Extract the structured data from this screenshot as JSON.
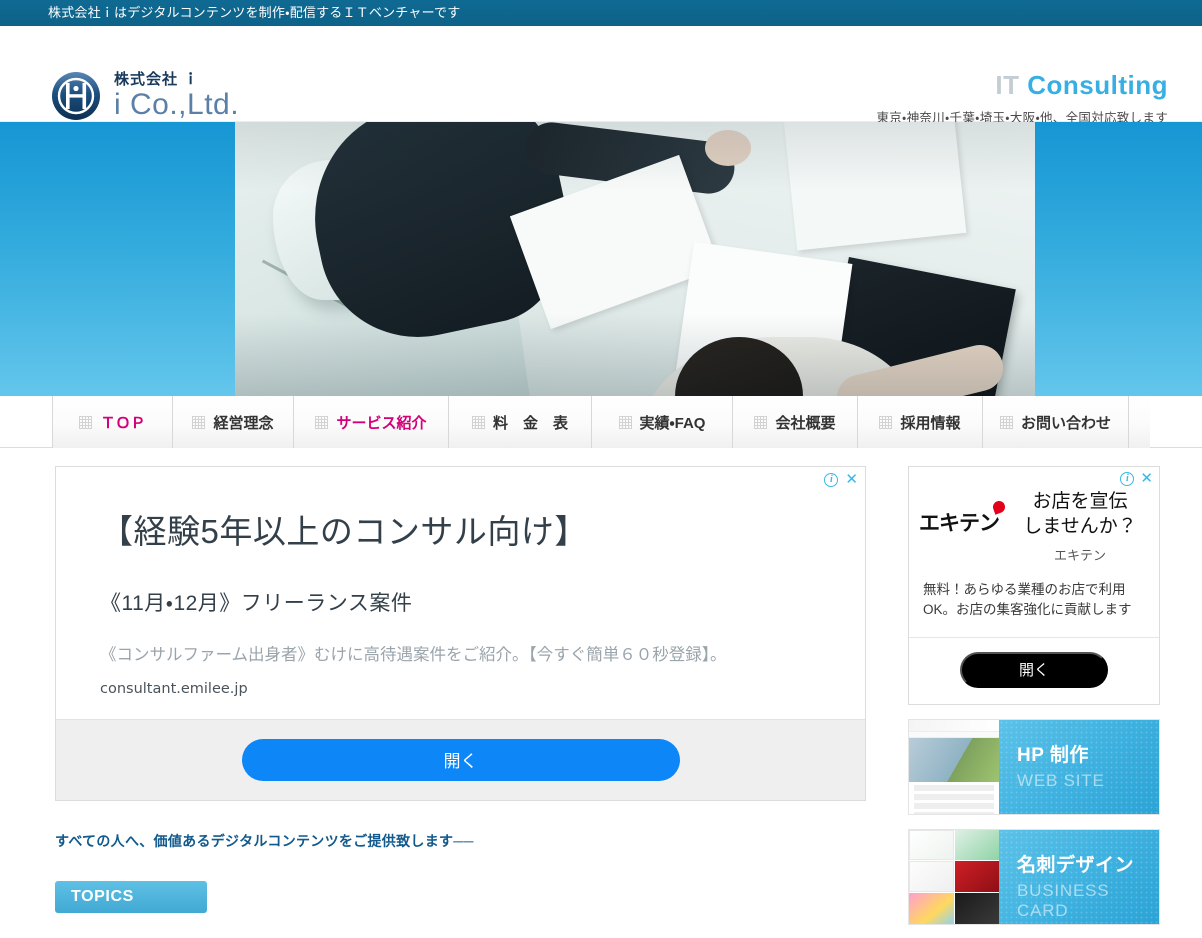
{
  "topbar": {
    "notice": "株式会社ｉはデジタルコンテンツを制作・配信するＩＴベンチャーです"
  },
  "header": {
    "logo_kana": "株式会社 ｉ",
    "logo_en": "i Co.,Ltd.",
    "title_it": "IT",
    "title_consulting": "Consulting",
    "subtitle": "東京・神奈川・千葉・埼玉・大阪・他、全国対応致します"
  },
  "nav": {
    "items": [
      {
        "label": "ＴＯＰ",
        "accent": true
      },
      {
        "label": "経営理念",
        "accent": false
      },
      {
        "label": "サービス紹介",
        "accent": true
      },
      {
        "label": "料　金　表",
        "accent": false
      },
      {
        "label": "実績・FAQ",
        "accent": false
      },
      {
        "label": "会社概要",
        "accent": false
      },
      {
        "label": "採用情報",
        "accent": false
      },
      {
        "label": "お問い合わせ",
        "accent": false
      }
    ]
  },
  "main_ad": {
    "headline": "【経験5年以上のコンサル向け】",
    "subhead": "《11月・12月》フリーランス案件",
    "description": "《コンサルファーム出身者》むけに高待遇案件をご紹介。【今すぐ簡単６０秒登録】。",
    "url": "consultant.emilee.jp",
    "cta": "開く",
    "info_icon": "info-icon",
    "close_icon": "close-icon"
  },
  "content": {
    "tagline": "すべての人へ、価値あるデジタルコンテンツをご提供致します──",
    "topics_label": "TOPICS"
  },
  "side_ad": {
    "brand_logo": "エキテン",
    "headline": "お店を宣伝\nしませんか？",
    "headline_line1": "お店を宣伝",
    "headline_line2": "しませんか？",
    "brand": "エキテン",
    "description": "無料！あらゆる業種のお店で利用OK。お店の集客強化に貢献します",
    "cta": "開く"
  },
  "banners": [
    {
      "jp": "HP 制作",
      "en": "WEB SITE",
      "thumb": "website-thumbnail"
    },
    {
      "jp": "名刺デザイン",
      "en": "BUSINESS CARD",
      "thumb": "business-card-thumbnail"
    }
  ],
  "colors": {
    "topbar": "#0d6288",
    "accent_pink": "#d4007a",
    "brand_blue": "#38afe3",
    "cta_blue": "#0d86f7",
    "heading_blue": "#12598c"
  }
}
